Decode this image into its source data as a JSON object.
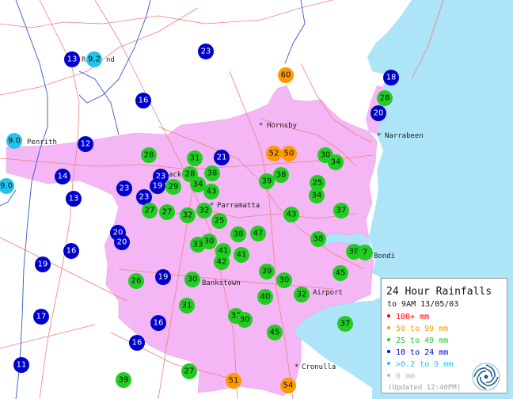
{
  "map": {
    "places": [
      {
        "id": "hornsby",
        "name": "Hornsby"
      },
      {
        "id": "narrabeen",
        "name": "Narrabeen"
      },
      {
        "id": "penrith",
        "name": "Penrith"
      },
      {
        "id": "blacktown",
        "name": "ack"
      },
      {
        "id": "richmond",
        "name": "R"
      },
      {
        "id": "richmond2",
        "name": "nd"
      },
      {
        "id": "parramatta",
        "name": "Parramatta"
      },
      {
        "id": "bondi",
        "name": "Bondi"
      },
      {
        "id": "bankstown",
        "name": "Bankstown"
      },
      {
        "id": "airport",
        "name": "Airport"
      },
      {
        "id": "cronulla",
        "name": "Cronulla"
      }
    ],
    "categories": {
      "c100": {
        "label": "100+ mm",
        "color": "#ff0000"
      },
      "c50": {
        "label": "50 to 99 mm",
        "color": "#ff9900"
      },
      "c25": {
        "label": "25 to 49 mm",
        "color": "#22cc22"
      },
      "c10": {
        "label": "10 to 24 mm",
        "color": "#0000cc"
      },
      "c02": {
        "label": ">0.2 to 9 mm",
        "color": "#22c4ee"
      },
      "c0": {
        "label": "0 mm",
        "color": "#bbbbbb"
      }
    },
    "stations": [
      {
        "v": "13",
        "c": "c10"
      },
      {
        "v": "9.2",
        "c": "c02"
      },
      {
        "v": "23",
        "c": "c10"
      },
      {
        "v": "60",
        "c": "c50"
      },
      {
        "v": "18",
        "c": "c10"
      },
      {
        "v": "28",
        "c": "c25"
      },
      {
        "v": "20",
        "c": "c10"
      },
      {
        "v": "16",
        "c": "c10"
      },
      {
        "v": "9.0",
        "c": "c02"
      },
      {
        "v": "12",
        "c": "c10"
      },
      {
        "v": "9.0",
        "c": "c02"
      },
      {
        "v": "28",
        "c": "c25"
      },
      {
        "v": "31",
        "c": "c25"
      },
      {
        "v": "21",
        "c": "c10"
      },
      {
        "v": "52",
        "c": "c50"
      },
      {
        "v": "50",
        "c": "c50"
      },
      {
        "v": "30",
        "c": "c25"
      },
      {
        "v": "34",
        "c": "c25"
      },
      {
        "v": "14",
        "c": "c10"
      },
      {
        "v": "28",
        "c": "c25"
      },
      {
        "v": "38",
        "c": "c25"
      },
      {
        "v": "23",
        "c": "c10"
      },
      {
        "v": "19",
        "c": "c10"
      },
      {
        "v": "29",
        "c": "c25"
      },
      {
        "v": "34",
        "c": "c25"
      },
      {
        "v": "43",
        "c": "c25"
      },
      {
        "v": "39",
        "c": "c25"
      },
      {
        "v": "38",
        "c": "c25"
      },
      {
        "v": "25",
        "c": "c25"
      },
      {
        "v": "13",
        "c": "c10"
      },
      {
        "v": "23",
        "c": "c10"
      },
      {
        "v": "23",
        "c": "c10"
      },
      {
        "v": "34",
        "c": "c25"
      },
      {
        "v": "27",
        "c": "c25"
      },
      {
        "v": "27",
        "c": "c25"
      },
      {
        "v": "32",
        "c": "c25"
      },
      {
        "v": "32",
        "c": "c25"
      },
      {
        "v": "43",
        "c": "c25"
      },
      {
        "v": "37",
        "c": "c25"
      },
      {
        "v": "25",
        "c": "c25"
      },
      {
        "v": "20",
        "c": "c10"
      },
      {
        "v": "20",
        "c": "c10"
      },
      {
        "v": "38",
        "c": "c25"
      },
      {
        "v": "47",
        "c": "c25"
      },
      {
        "v": "38",
        "c": "c25"
      },
      {
        "v": "16",
        "c": "c10"
      },
      {
        "v": "30",
        "c": "c25"
      },
      {
        "v": "33",
        "c": "c25"
      },
      {
        "v": "41",
        "c": "c25"
      },
      {
        "v": "42",
        "c": "c25"
      },
      {
        "v": "41",
        "c": "c25"
      },
      {
        "v": "39",
        "c": "c25"
      },
      {
        "v": "7",
        "c": "c25"
      },
      {
        "v": "19",
        "c": "c10"
      },
      {
        "v": "39",
        "c": "c25"
      },
      {
        "v": "45",
        "c": "c25"
      },
      {
        "v": "26",
        "c": "c25"
      },
      {
        "v": "19",
        "c": "c10"
      },
      {
        "v": "30",
        "c": "c25"
      },
      {
        "v": "30",
        "c": "c25"
      },
      {
        "v": "40",
        "c": "c25"
      },
      {
        "v": "32",
        "c": "c25"
      },
      {
        "v": "31",
        "c": "c25"
      },
      {
        "v": "17",
        "c": "c10"
      },
      {
        "v": "32",
        "c": "c25"
      },
      {
        "v": "30",
        "c": "c25"
      },
      {
        "v": "16",
        "c": "c10"
      },
      {
        "v": "45",
        "c": "c25"
      },
      {
        "v": "37",
        "c": "c25"
      },
      {
        "v": "16",
        "c": "c10"
      },
      {
        "v": "11",
        "c": "c10"
      },
      {
        "v": "27",
        "c": "c25"
      },
      {
        "v": "39",
        "c": "c25"
      },
      {
        "v": "51",
        "c": "c50"
      },
      {
        "v": "54",
        "c": "c50"
      }
    ]
  },
  "legend": {
    "title": "24 Hour Rainfalls",
    "subtitle": "to 9AM 13/05/03",
    "items": [
      {
        "label": "100+ mm",
        "color": "#ff0000"
      },
      {
        "label": "50 to 99 mm",
        "color": "#ff9900"
      },
      {
        "label": "25 to 49 mm",
        "color": "#22cc22"
      },
      {
        "label": "10 to 24 mm",
        "color": "#0000cc"
      },
      {
        "label": ">0.2 to 9 mm",
        "color": "#22c4ee"
      },
      {
        "label": "0 mm",
        "color": "#bbbbbb"
      }
    ],
    "updated": "(Updated 12:40PM)"
  }
}
